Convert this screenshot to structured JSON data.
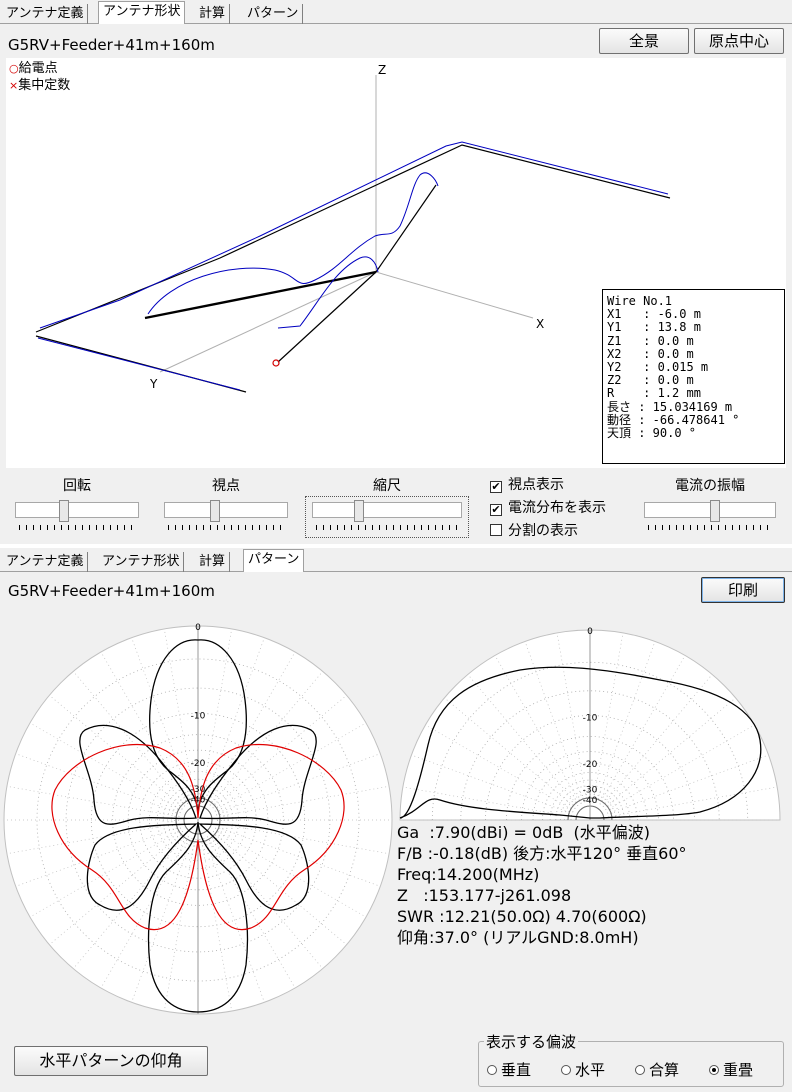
{
  "top_window": {
    "tabs": [
      "アンテナ定義",
      "アンテナ形状",
      "計算",
      "パターン"
    ],
    "active_tab": "アンテナ形状",
    "antenna_name": "G5RV+Feeder+41m+160m",
    "buttons": {
      "full_view": "全景",
      "origin_center": "原点中心"
    },
    "legend": {
      "feed_point": "給電点",
      "feed_mark": "○",
      "lumped": "集中定数",
      "lumped_mark": "×"
    },
    "axes": {
      "x": "X",
      "y": "Y",
      "z": "Z"
    },
    "wire_info": [
      "Wire No.1",
      "X1   : -6.0 m",
      "Y1   : 13.8 m",
      "Z1   : 0.0 m",
      "X2   : 0.0 m",
      "Y2   : 0.015 m",
      "Z2   : 0.0 m",
      "R    : 1.2 mm",
      "長さ : 15.034169 m",
      "動径 : -66.478641 °",
      "天頂 : 90.0 °"
    ],
    "controls": {
      "rotation": "回転",
      "viewpoint": "視点",
      "scale": "縮尺",
      "current_amplitude": "電流の振幅"
    },
    "checkboxes": [
      {
        "label": "視点表示",
        "checked": true
      },
      {
        "label": "電流分布を表示",
        "checked": true
      },
      {
        "label": "分割の表示",
        "checked": false
      }
    ]
  },
  "bottom_window": {
    "tabs": [
      "アンテナ定義",
      "アンテナ形状",
      "計算",
      "パターン"
    ],
    "active_tab": "パターン",
    "antenna_name": "G5RV+Feeder+41m+160m",
    "print_button": "印刷",
    "ring_labels": [
      "0",
      "-10",
      "-20",
      "-30",
      "-40"
    ],
    "results": {
      "ga": "Ga  :7.90(dBi) = 0dB  (水平偏波)",
      "fb": "F/B :-0.18(dB) 後方:水平120° 垂直60°",
      "freq": "Freq:14.200(MHz)",
      "z": "Z   :153.177-j261.098",
      "swr": "SWR :12.21(50.0Ω) 4.70(600Ω)",
      "elev": "仰角:37.0° (リアルGND:8.0mH)"
    },
    "elevation_button": "水平パターンの仰角",
    "polarization": {
      "title": "表示する偏波",
      "options": [
        "垂直",
        "水平",
        "合算",
        "重畳"
      ],
      "selected": "重畳"
    },
    "colors": {
      "horizontal_pattern": "#000000",
      "second_pattern": "#e00000",
      "current": "#0000c0"
    }
  }
}
